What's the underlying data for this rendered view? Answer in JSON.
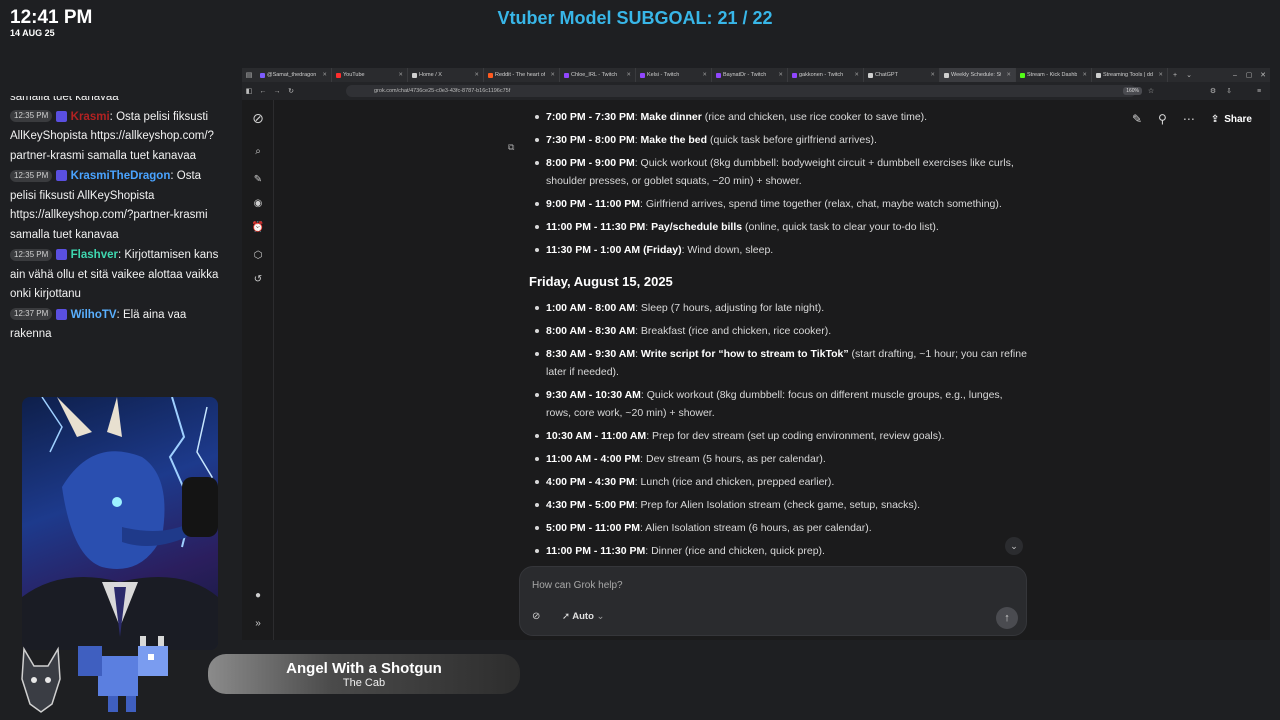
{
  "overlay": {
    "time": "12:41 PM",
    "date": "14 AUG 25",
    "subgoal": "Vtuber Model SUBGOAL: 21 / 22",
    "song_title": "Angel With a Shotgun",
    "song_artist": "The Cab"
  },
  "chat": {
    "partial_top": "samalla tuet kanavaa",
    "messages": [
      {
        "time": "12:35 PM",
        "user": "Krasmi",
        "user_color": "#b22222",
        "sep": ":",
        "text": "Osta pelisi fiksusti AllKeyShopista https://allkeyshop.com/?partner-krasmi samalla tuet kanavaa"
      },
      {
        "time": "12:35 PM",
        "user": "KrasmiTheDragon",
        "user_color": "#4aa3ff",
        "sep": ":",
        "text": "Osta pelisi fiksusti AllKeyShopista https://allkeyshop.com/?partner-krasmi samalla tuet kanavaa"
      },
      {
        "time": "12:35 PM",
        "user": "Flashver",
        "user_color": "#3fd7b0",
        "sep": ":",
        "text": "Kirjottamisen kans ain vähä ollu et sitä vaikee alottaa vaikka onki kirjottanu"
      },
      {
        "time": "12:37 PM",
        "user": "WilhoTV",
        "user_color": "#5ab0ff",
        "sep": ":",
        "text": "Elä aina vaa rakenna"
      }
    ]
  },
  "browser": {
    "tabs": [
      {
        "label": "@Samat_thedragon ·",
        "color": "#7d5cff"
      },
      {
        "label": "YouTube",
        "color": "#ff2d2d"
      },
      {
        "label": "Home / X",
        "color": "#cfcfcf"
      },
      {
        "label": "Reddit - The heart of th",
        "color": "#ff5a1f"
      },
      {
        "label": "Chloe_IRL - Twitch",
        "color": "#9146ff"
      },
      {
        "label": "Kelsi - Twitch",
        "color": "#9146ff"
      },
      {
        "label": "BaynatDr - Twitch",
        "color": "#9146ff"
      },
      {
        "label": "gakkonen - Twitch",
        "color": "#9146ff"
      },
      {
        "label": "ChatGPT",
        "color": "#cfcfcf"
      },
      {
        "label": "Weekly Schedule: Strea",
        "color": "#cfcfcf",
        "active": true
      },
      {
        "label": "Stream - Kick Dashboard",
        "color": "#53fc18"
      },
      {
        "label": "Streaming Tools | ddde",
        "color": "#cfcfcf"
      }
    ],
    "url": "grok.com/chat/4736ce25-c0e3-43fc-8787-b16c1196c75f",
    "zoom": "160%"
  },
  "grok": {
    "share_label": "Share",
    "input_placeholder": "How can Grok help?",
    "mode_label": "Auto",
    "thursday_items": [
      {
        "time": "7:00 PM - 7:30 PM",
        "title": "Make dinner",
        "rest": " (rice and chicken, use rice cooker to save time)."
      },
      {
        "time": "7:30 PM - 8:00 PM",
        "title": "Make the bed",
        "rest": " (quick task before girlfriend arrives)."
      },
      {
        "time": "8:00 PM - 9:00 PM",
        "title": "",
        "rest": "Quick workout (8kg dumbbell: bodyweight circuit + dumbbell exercises like curls, shoulder presses, or goblet squats, ~20 min) + shower."
      },
      {
        "time": "9:00 PM - 11:00 PM",
        "title": "",
        "rest": "Girlfriend arrives, spend time together (relax, chat, maybe watch something)."
      },
      {
        "time": "11:00 PM - 11:30 PM",
        "title": "Pay/schedule bills",
        "rest": " (online, quick task to clear your to-do list)."
      },
      {
        "time": "11:30 PM - 1:00 AM (Friday)",
        "title": "",
        "rest": "Wind down, sleep."
      }
    ],
    "friday_heading": "Friday, August 15, 2025",
    "friday_items": [
      {
        "time": "1:00 AM - 8:00 AM",
        "title": "",
        "rest": "Sleep (7 hours, adjusting for late night)."
      },
      {
        "time": "8:00 AM - 8:30 AM",
        "title": "",
        "rest": "Breakfast (rice and chicken, rice cooker)."
      },
      {
        "time": "8:30 AM - 9:30 AM",
        "title": "Write script for “how to stream to TikTok”",
        "rest": " (start drafting, ~1 hour; you can refine later if needed)."
      },
      {
        "time": "9:30 AM - 10:30 AM",
        "title": "",
        "rest": "Quick workout (8kg dumbbell: focus on different muscle groups, e.g., lunges, rows, core work, ~20 min) + shower."
      },
      {
        "time": "10:30 AM - 11:00 AM",
        "title": "",
        "rest": "Prep for dev stream (set up coding environment, review goals)."
      },
      {
        "time": "11:00 AM - 4:00 PM",
        "title": "",
        "rest": "Dev stream (5 hours, as per calendar)."
      },
      {
        "time": "4:00 PM - 4:30 PM",
        "title": "",
        "rest": "Lunch (rice and chicken, prepped earlier)."
      },
      {
        "time": "4:30 PM - 5:00 PM",
        "title": "",
        "rest": "Prep for Alien Isolation stream (check game, setup, snacks)."
      },
      {
        "time": "5:00 PM - 11:00 PM",
        "title": "",
        "rest": "Alien Isolation stream (6 hours, as per calendar)."
      },
      {
        "time": "11:00 PM - 11:30 PM",
        "title": "",
        "rest": "Dinner (rice and chicken, quick prep)."
      }
    ]
  }
}
